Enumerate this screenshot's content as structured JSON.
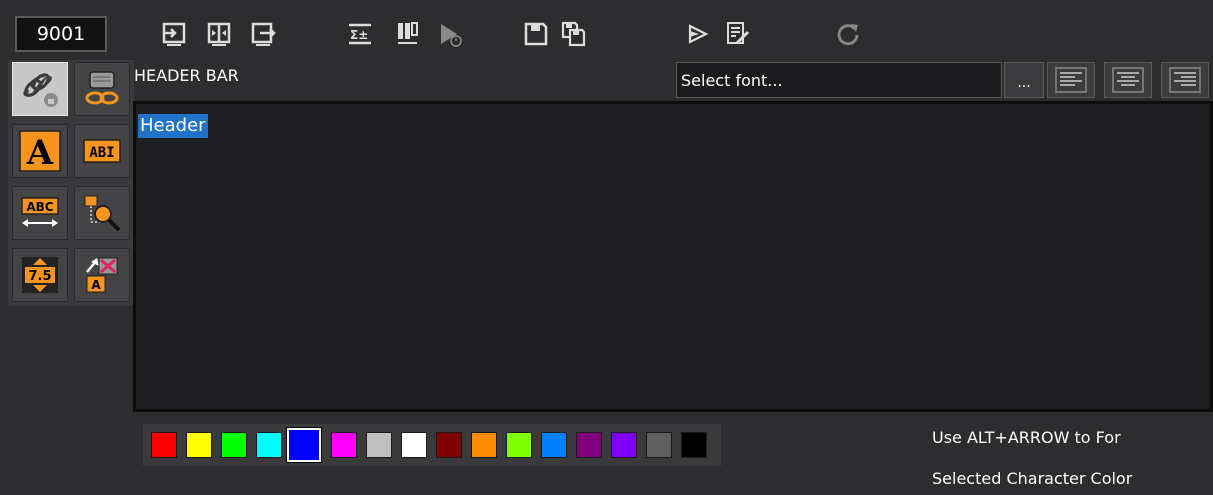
{
  "toolbar": {
    "id_value": "9001",
    "buttons": [
      {
        "name": "import-icon"
      },
      {
        "name": "center-split-icon"
      },
      {
        "name": "export-icon"
      },
      {
        "name": "insert-field-icon"
      },
      {
        "name": "column-layout-icon"
      },
      {
        "name": "timed-play-icon"
      },
      {
        "name": "save-icon"
      },
      {
        "name": "save-as-icon"
      },
      {
        "name": "play-icon"
      },
      {
        "name": "edit-document-icon"
      },
      {
        "name": "refresh-icon"
      }
    ]
  },
  "palette": {
    "tools": [
      {
        "name": "link-tool-icon",
        "active": true
      },
      {
        "name": "chain-link-tool-icon",
        "active": false
      },
      {
        "name": "text-style-tool-icon",
        "active": false,
        "glyph": "A",
        "color": "#f7941d"
      },
      {
        "name": "text-field-tool-icon",
        "active": false,
        "glyph": "ABI"
      },
      {
        "name": "text-width-tool-icon",
        "active": false,
        "glyph": "ABC"
      },
      {
        "name": "zoom-tool-icon",
        "active": false
      },
      {
        "name": "size-adjust-tool-icon",
        "active": false,
        "glyph": "7.5"
      },
      {
        "name": "scale-text-tool-icon",
        "active": false,
        "glyph": "A"
      }
    ]
  },
  "header": {
    "label": "HEADER BAR",
    "font_value": "Select font...",
    "browse_label": "..."
  },
  "editor": {
    "text": "Header",
    "selection_color": "#1f73c8"
  },
  "swatches": [
    {
      "color": "#ff0000"
    },
    {
      "color": "#ffff00"
    },
    {
      "color": "#00ff00"
    },
    {
      "color": "#00ffff"
    },
    {
      "color": "#0000ff",
      "selected": true
    },
    {
      "color": "#ff00ff"
    },
    {
      "color": "#c0c0c0"
    },
    {
      "color": "#ffffff"
    },
    {
      "color": "#800000"
    },
    {
      "color": "#ff8c00"
    },
    {
      "color": "#80ff00"
    },
    {
      "color": "#0080ff"
    },
    {
      "color": "#800080"
    },
    {
      "color": "#8000ff"
    },
    {
      "color": "#606060"
    },
    {
      "color": "#000000"
    }
  ],
  "hints": {
    "line1": "Use ALT+ARROW to For",
    "line2": "Selected Character Color"
  },
  "colors": {
    "background": "#2d2d30",
    "accent_orange": "#f7941d",
    "icon_light": "#dcdcdc",
    "icon_dim": "#8a8a8a"
  }
}
